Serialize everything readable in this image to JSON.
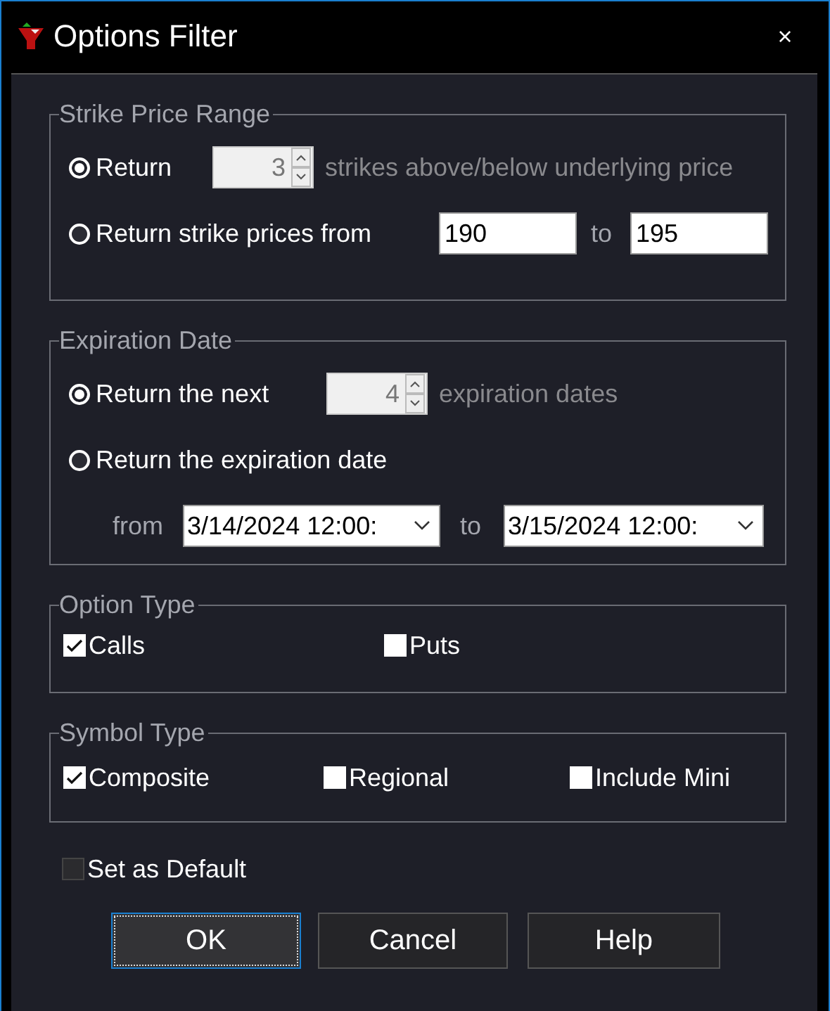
{
  "window": {
    "title": "Options Filter",
    "close": "×"
  },
  "strike_price_range": {
    "legend": "Strike Price Range",
    "options": [
      {
        "kind": "spinner",
        "label": "Return",
        "selected": true,
        "value": "3",
        "disabled": true,
        "suffix": "strikes above/below underlying price"
      },
      {
        "kind": "range",
        "label": "Return strike prices from",
        "selected": false,
        "from": "190",
        "to_label": "to",
        "to": "195"
      }
    ]
  },
  "expiration_date": {
    "legend": "Expiration Date",
    "options": [
      {
        "kind": "spinner",
        "label": "Return the next",
        "selected": true,
        "value": "4",
        "disabled": true,
        "suffix": "expiration dates"
      },
      {
        "kind": "dates",
        "label": "Return the expiration date",
        "selected": false,
        "from_label": "from",
        "from": "3/14/2024 12:00:",
        "to_label": "to",
        "to": "3/15/2024 12:00:"
      }
    ]
  },
  "option_type": {
    "legend": "Option Type",
    "items": [
      {
        "label": "Calls",
        "checked": true
      },
      {
        "label": "Puts",
        "checked": false
      }
    ]
  },
  "symbol_type": {
    "legend": "Symbol Type",
    "items": [
      {
        "label": "Composite",
        "checked": true
      },
      {
        "label": "Regional",
        "checked": false
      },
      {
        "label": "Include Mini",
        "checked": false
      }
    ]
  },
  "set_as_default": {
    "label": "Set as Default",
    "checked": false,
    "disabled": true
  },
  "buttons": [
    {
      "label": "OK",
      "focused": true
    },
    {
      "label": "Cancel",
      "focused": false
    },
    {
      "label": "Help",
      "focused": false
    }
  ]
}
